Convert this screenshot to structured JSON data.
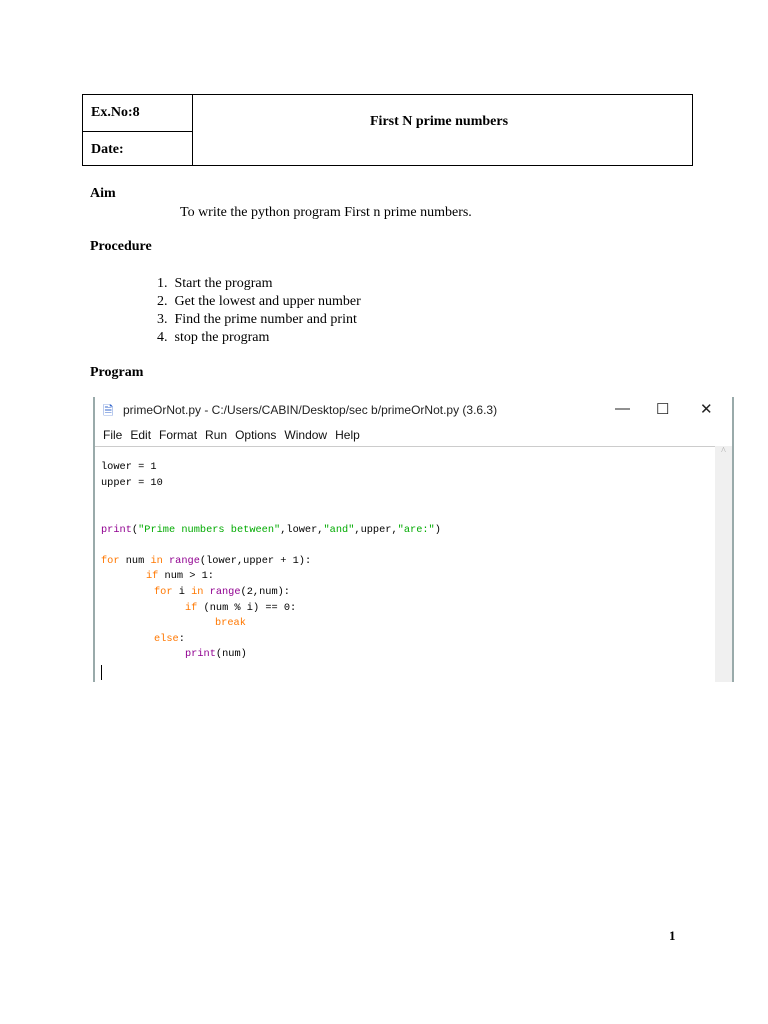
{
  "header": {
    "exno": "Ex.No:8",
    "date": "Date:",
    "title": "First N prime numbers"
  },
  "aim": {
    "heading": "Aim",
    "text": "To write the python program First n prime numbers."
  },
  "procedure": {
    "heading": "Procedure",
    "steps": [
      "1.  Start the program",
      "2.  Get the lowest and upper number",
      "3.  Find the prime number and print",
      "4.  stop the program"
    ]
  },
  "program": {
    "heading": "Program"
  },
  "window": {
    "title": "primeOrNot.py - C:/Users/CABIN/Desktop/sec b/primeOrNot.py (3.6.3)",
    "minimize": "—",
    "maximize": "☐",
    "close": "✕",
    "menu": [
      "File",
      "Edit",
      "Format",
      "Run",
      "Options",
      "Window",
      "Help"
    ],
    "code": {
      "l1": "lower = 1",
      "l2": "upper = 10",
      "l3a": "print",
      "l3b": "(",
      "l3c": "\"Prime numbers between\"",
      "l3d": ",lower,",
      "l3e": "\"and\"",
      "l3f": ",upper,",
      "l3g": "\"are:\"",
      "l3h": ")",
      "l4a": "for",
      "l4b": " num ",
      "l4c": "in",
      "l4d": " ",
      "l4e": "range",
      "l4f": "(lower,upper + 1):",
      "l5a": "if",
      "l5b": " num > 1:",
      "l6a": "for",
      "l6b": " i ",
      "l6c": "in",
      "l6d": " ",
      "l6e": "range",
      "l6f": "(2,num):",
      "l7a": "if",
      "l7b": " (num % i) == 0:",
      "l8": "break",
      "l9a": "else",
      "l9b": ":",
      "l10a": "print",
      "l10b": "(num)"
    }
  },
  "page_number": "1"
}
